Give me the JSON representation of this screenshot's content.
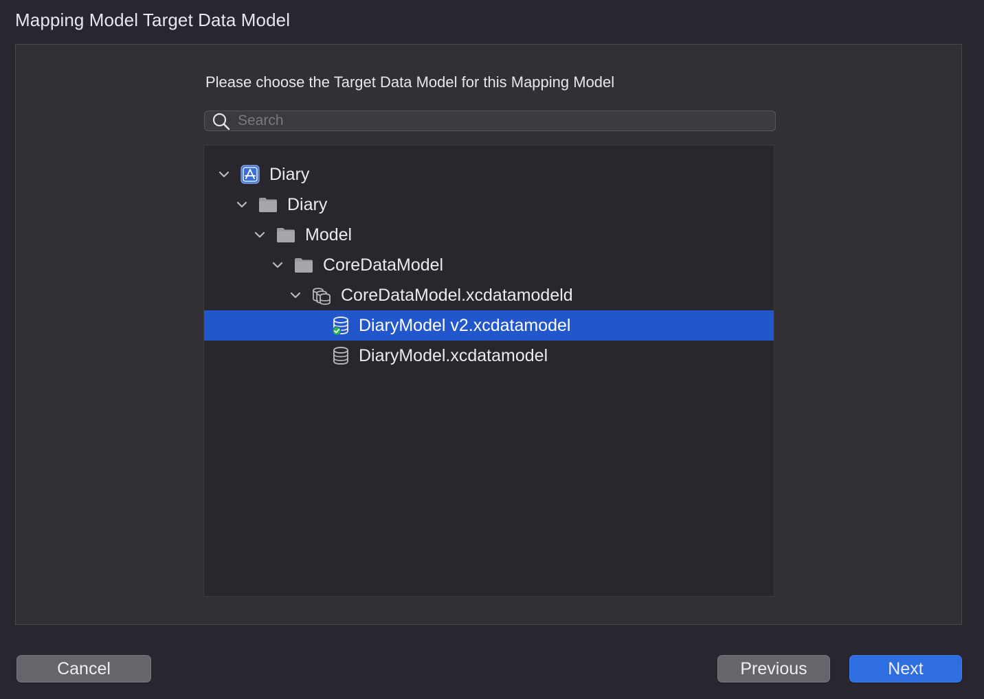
{
  "header": {
    "title": "Mapping Model Target Data Model"
  },
  "main": {
    "instruction": "Please choose the Target Data Model for this Mapping Model",
    "search": {
      "placeholder": "Search",
      "value": ""
    },
    "tree": {
      "items": [
        {
          "label": "Diary",
          "icon": "app-project-icon",
          "expanded": true,
          "selected": false
        },
        {
          "label": "Diary",
          "icon": "folder-icon",
          "expanded": true,
          "selected": false
        },
        {
          "label": "Model",
          "icon": "folder-icon",
          "expanded": true,
          "selected": false
        },
        {
          "label": "CoreDataModel",
          "icon": "folder-icon",
          "expanded": true,
          "selected": false
        },
        {
          "label": "CoreDataModel.xcdatamodeld",
          "icon": "versioned-data-model-icon",
          "expanded": true,
          "selected": false
        },
        {
          "label": "DiaryModel v2.xcdatamodel",
          "icon": "data-model-current-version-icon",
          "selected": true
        },
        {
          "label": "DiaryModel.xcdatamodel",
          "icon": "data-model-icon",
          "selected": false
        }
      ]
    }
  },
  "footer": {
    "cancel_label": "Cancel",
    "previous_label": "Previous",
    "next_label": "Next"
  },
  "colors": {
    "selection": "#2256cb",
    "primary_button": "#2f6ee0",
    "secondary_button": "#67646b",
    "check_badge": "#2fb24c"
  }
}
